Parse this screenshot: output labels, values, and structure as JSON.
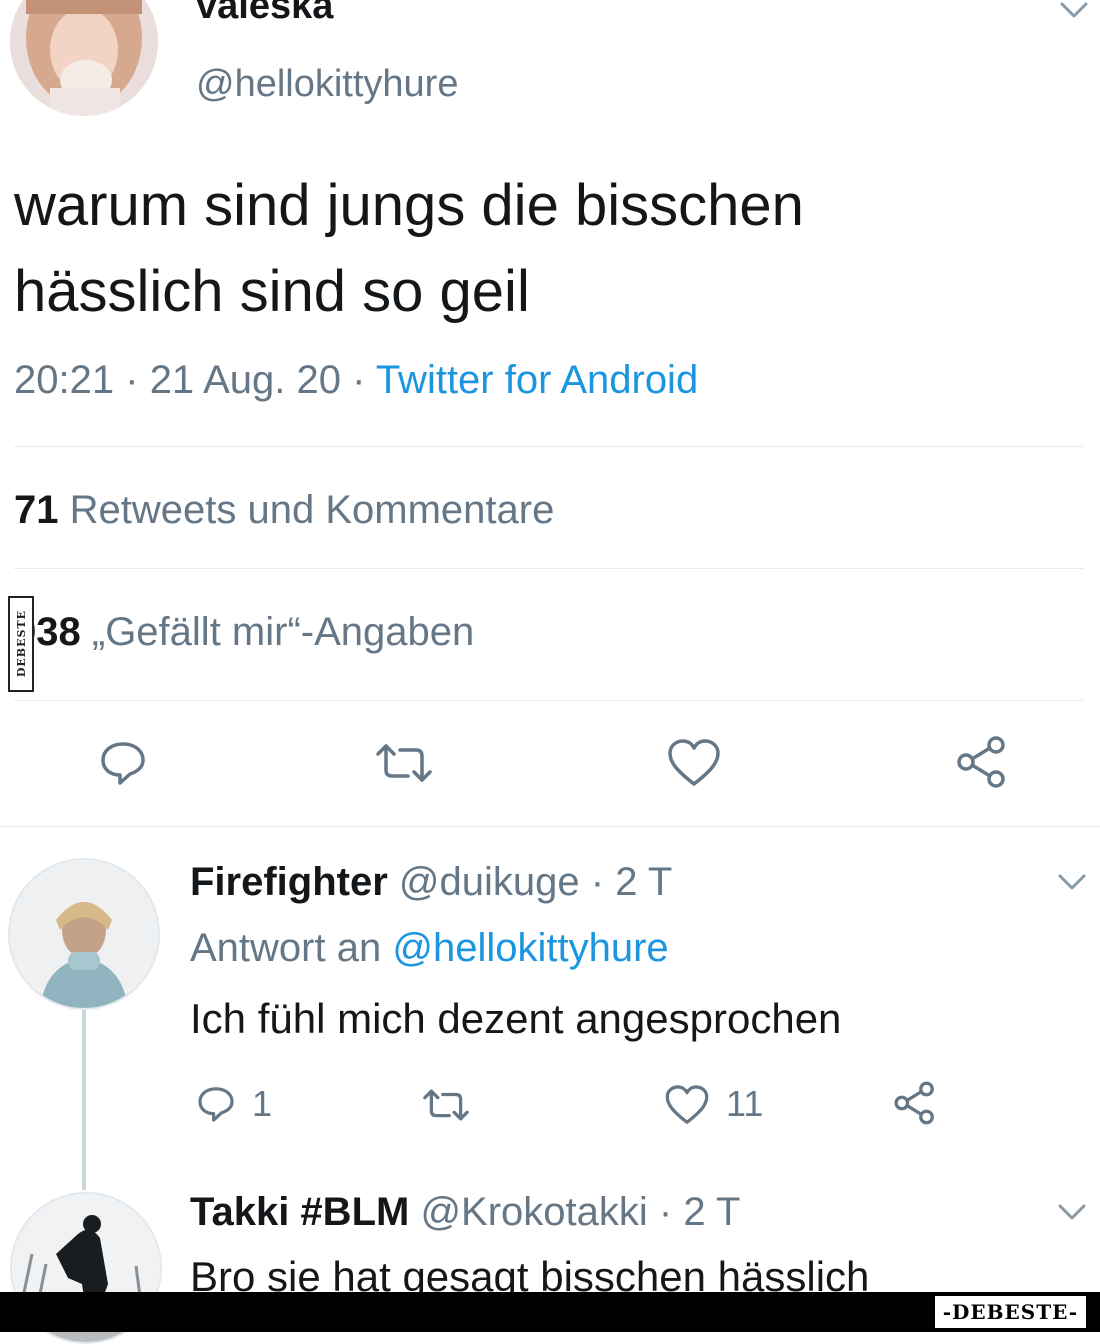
{
  "tweet": {
    "display_name": "valeska",
    "handle": "@hellokittyhure",
    "text_line1": "warum sind jungs die bisschen",
    "text_line2": "hässlich sind so geil",
    "time": "20:21",
    "date": "21 Aug. 20",
    "separator": "·",
    "source": "Twitter for Android",
    "retweets_count": "71",
    "retweets_label": "Retweets und Kommentare",
    "likes_count": "938",
    "likes_label": "„Gefällt mir“-Angaben",
    "actions": [
      "comment-icon",
      "retweet-icon",
      "heart-icon",
      "share-icon"
    ]
  },
  "replies": [
    {
      "display_name": "Firefighter",
      "handle": "@duikuge",
      "age": "· 2 T",
      "reply_prefix": "Antwort an",
      "reply_to": "@hellokittyhure",
      "text": "Ich fühl mich dezent angesprochen",
      "comment_count": "1",
      "like_count": "11"
    },
    {
      "display_name": "Takki #BLM",
      "handle": "@Krokotakki",
      "age": "· 2 T",
      "text": "Bro sie hat gesagt bisschen hässlich"
    }
  ],
  "watermarks": {
    "side": "DEBESTE",
    "bottom": "-DEBESTE-"
  },
  "colors": {
    "text": "#14171a",
    "muted": "#657786",
    "link": "#1b95e0",
    "divider": "#e6ecf0"
  }
}
